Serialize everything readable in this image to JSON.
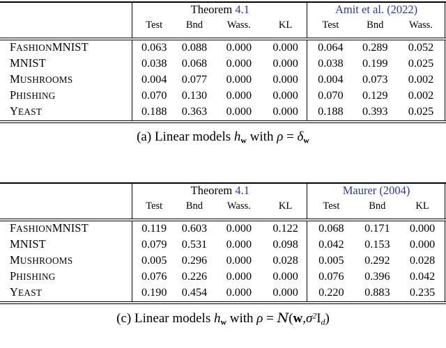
{
  "tables": [
    {
      "id": "table-a",
      "groups": [
        {
          "name": "Theorem",
          "ref": "4.1",
          "ref_is_link": true,
          "name_is_link": false,
          "columns": [
            "Test",
            "Bnd",
            "Wass.",
            "KL"
          ]
        },
        {
          "name": "Amit et al.",
          "ref": "(2022)",
          "ref_is_link": true,
          "name_is_link": true,
          "columns": [
            "Test",
            "Bnd",
            "Wass."
          ]
        }
      ],
      "rows": [
        {
          "label_first": "F",
          "label_rest": "ASHION",
          "label_tail_first": "MNIST",
          "label_tail_rest": "",
          "label": "FashionMNIST",
          "values_left": [
            "0.063",
            "0.088",
            "0.000",
            "0.000"
          ],
          "values_right": [
            "0.064",
            "0.289",
            "0.052"
          ]
        },
        {
          "label_first": "MNIST",
          "label_rest": "",
          "label_tail_first": "",
          "label_tail_rest": "",
          "label": "MNIST",
          "values_left": [
            "0.038",
            "0.068",
            "0.000",
            "0.000"
          ],
          "values_right": [
            "0.038",
            "0.199",
            "0.025"
          ]
        },
        {
          "label_first": "M",
          "label_rest": "USHROOMS",
          "label_tail_first": "",
          "label_tail_rest": "",
          "label": "Mushrooms",
          "values_left": [
            "0.004",
            "0.077",
            "0.000",
            "0.000"
          ],
          "values_right": [
            "0.004",
            "0.073",
            "0.002"
          ]
        },
        {
          "label_first": "P",
          "label_rest": "HISHING",
          "label_tail_first": "",
          "label_tail_rest": "",
          "label": "Phishing",
          "values_left": [
            "0.070",
            "0.130",
            "0.000",
            "0.000"
          ],
          "values_right": [
            "0.070",
            "0.129",
            "0.002"
          ]
        },
        {
          "label_first": "Y",
          "label_rest": "EAST",
          "label_tail_first": "",
          "label_tail_rest": "",
          "label": "Yeast",
          "values_left": [
            "0.188",
            "0.363",
            "0.000",
            "0.000"
          ],
          "values_right": [
            "0.188",
            "0.393",
            "0.025"
          ]
        }
      ],
      "caption": {
        "tag": "(a)",
        "text_before": "Linear models",
        "model": "h",
        "model_sub": "w",
        "text_mid": "with",
        "rho": "ρ",
        "equals": "=",
        "dist": "δ",
        "dist_sub": "w",
        "full": "(a) Linear models h_w with ρ = δ_w"
      }
    },
    {
      "id": "table-c",
      "groups": [
        {
          "name": "Theorem",
          "ref": "4.1",
          "ref_is_link": true,
          "name_is_link": false,
          "columns": [
            "Test",
            "Bnd",
            "Wass.",
            "KL"
          ]
        },
        {
          "name": "Maurer",
          "ref": "(2004)",
          "ref_is_link": true,
          "name_is_link": true,
          "columns": [
            "Test",
            "Bnd",
            "KL"
          ]
        }
      ],
      "rows": [
        {
          "label_first": "F",
          "label_rest": "ASHION",
          "label_tail_first": "MNIST",
          "label_tail_rest": "",
          "label": "FashionMNIST",
          "values_left": [
            "0.119",
            "0.603",
            "0.000",
            "0.122"
          ],
          "values_right": [
            "0.068",
            "0.171",
            "0.000"
          ]
        },
        {
          "label_first": "MNIST",
          "label_rest": "",
          "label_tail_first": "",
          "label_tail_rest": "",
          "label": "MNIST",
          "values_left": [
            "0.079",
            "0.531",
            "0.000",
            "0.098"
          ],
          "values_right": [
            "0.042",
            "0.153",
            "0.000"
          ]
        },
        {
          "label_first": "M",
          "label_rest": "USHROOMS",
          "label_tail_first": "",
          "label_tail_rest": "",
          "label": "Mushrooms",
          "values_left": [
            "0.005",
            "0.296",
            "0.000",
            "0.028"
          ],
          "values_right": [
            "0.005",
            "0.292",
            "0.028"
          ]
        },
        {
          "label_first": "P",
          "label_rest": "HISHING",
          "label_tail_first": "",
          "label_tail_rest": "",
          "label": "Phishing",
          "values_left": [
            "0.076",
            "0.226",
            "0.000",
            "0.000"
          ],
          "values_right": [
            "0.076",
            "0.396",
            "0.042"
          ]
        },
        {
          "label_first": "Y",
          "label_rest": "EAST",
          "label_tail_first": "",
          "label_tail_rest": "",
          "label": "Yeast",
          "values_left": [
            "0.190",
            "0.454",
            "0.000",
            "0.000"
          ],
          "values_right": [
            "0.220",
            "0.883",
            "0.235"
          ]
        }
      ],
      "caption": {
        "tag": "(c)",
        "text_before": "Linear models",
        "model": "h",
        "model_sub": "w",
        "text_mid": "with",
        "rho": "ρ",
        "equals": "=",
        "dist": "Ν",
        "dist_sub": "",
        "full": "(c) Linear models h_w with ρ = N(w, σ²I_d)",
        "dist_args_open": "(",
        "dist_arg1": "w",
        "dist_comma": ",",
        "dist_sigma": "σ",
        "dist_sigma_pow": "2",
        "dist_identity": "I",
        "dist_identity_sub": "d",
        "dist_args_close": ")"
      }
    }
  ],
  "colors": {
    "link": "#2a38a8",
    "text": "#000000",
    "rule": "#000000"
  }
}
